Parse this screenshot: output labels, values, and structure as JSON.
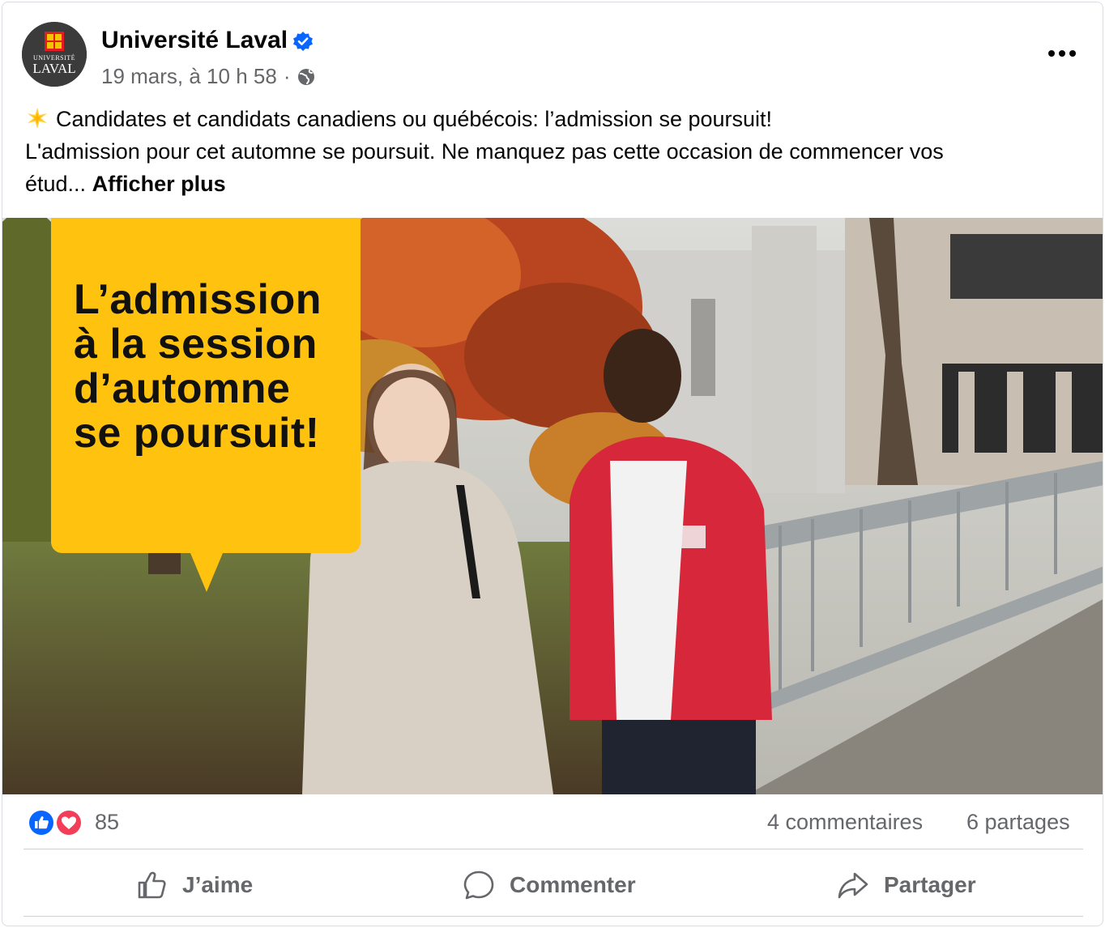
{
  "post": {
    "page_name": "Université Laval",
    "verified_icon": "verified-badge-icon",
    "timestamp": "19 mars, à 10 h 58",
    "separator": "·",
    "audience_icon": "globe-icon",
    "more_icon": "more-options-icon",
    "text_line1": "Candidates et candidats canadiens ou québécois: l’admission se poursuit!",
    "text_line2": "L'admission pour cet automne se poursuit. Ne manquez pas cette occasion de commencer vos",
    "text_line3_prefix": "étud...",
    "see_more": "Afficher plus",
    "emoji_icon": "glowing-star-icon"
  },
  "avatar": {
    "logo_line1": "UNIVERSITÉ",
    "logo_line2": "LAVAL"
  },
  "image": {
    "bubble_lines": [
      "L’admission",
      "à la session",
      "d’automne",
      "se poursuit!"
    ],
    "bubble_color": "#FFC20E"
  },
  "stats": {
    "reactions_count": "85",
    "comments": "4 commentaires",
    "shares": "6 partages"
  },
  "actions": {
    "like": "J’aime",
    "comment": "Commenter",
    "share": "Partager"
  },
  "colors": {
    "like_blue": "#0866FF",
    "love_red": "#F33E58",
    "secondary_text": "#65676B"
  }
}
